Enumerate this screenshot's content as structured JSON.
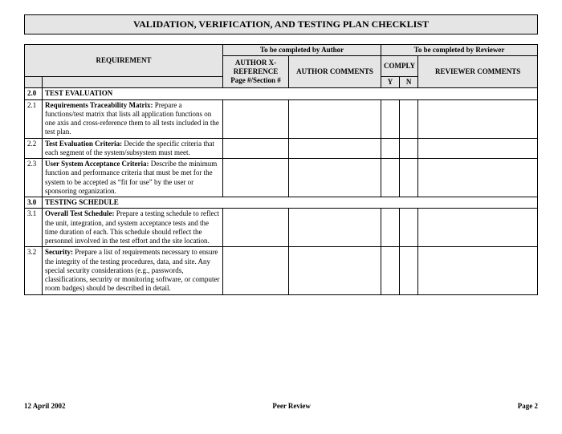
{
  "title": "VALIDATION, VERIFICATION, AND TESTING PLAN CHECKLIST",
  "headers": {
    "requirement": "REQUIREMENT",
    "author_group": "To be completed by Author",
    "reviewer_group": "To be completed by Reviewer",
    "xref": "AUTHOR X-REFERENCE Page #/Section #",
    "author_comments": "AUTHOR COMMENTS",
    "comply": "COMPLY",
    "reviewer_comments": "REVIEWER COMMENTS",
    "y": "Y",
    "n": "N"
  },
  "sections": [
    {
      "num": "2.0",
      "label": "TEST EVALUATION",
      "rows": [
        {
          "num": "2.1",
          "title": "Requirements Traceability Matrix:",
          "text": "  Prepare a functions/test matrix that lists all application functions on one axis and cross-reference them to all tests included in the test plan."
        },
        {
          "num": "2.2",
          "title": "Test Evaluation Criteria:",
          "text": "  Decide the specific criteria that each segment of the system/subsystem must meet."
        },
        {
          "num": "2.3",
          "title": "User System Acceptance Criteria:",
          "text": "  Describe the minimum function and performance criteria that must be met for the system to be accepted as “fit for use” by the user or sponsoring organization."
        }
      ]
    },
    {
      "num": "3.0",
      "label": "TESTING SCHEDULE",
      "rows": [
        {
          "num": "3.1",
          "title": "Overall Test Schedule:",
          "text": "  Prepare a testing schedule to reflect the unit, integration, and system acceptance tests and the time duration of each.  This schedule should reflect the personnel involved in the test effort and the site location."
        },
        {
          "num": "3.2",
          "title": "Security:",
          "text": "  Prepare a list of requirements necessary to ensure the integrity of the testing procedures, data, and site.  Any special security considerations (e.g., passwords, classifications, security or monitoring software, or computer room badges) should be described in detail."
        }
      ]
    }
  ],
  "footer": {
    "date": "12 April 2002",
    "center": "Peer Review",
    "page": "Page 2"
  }
}
